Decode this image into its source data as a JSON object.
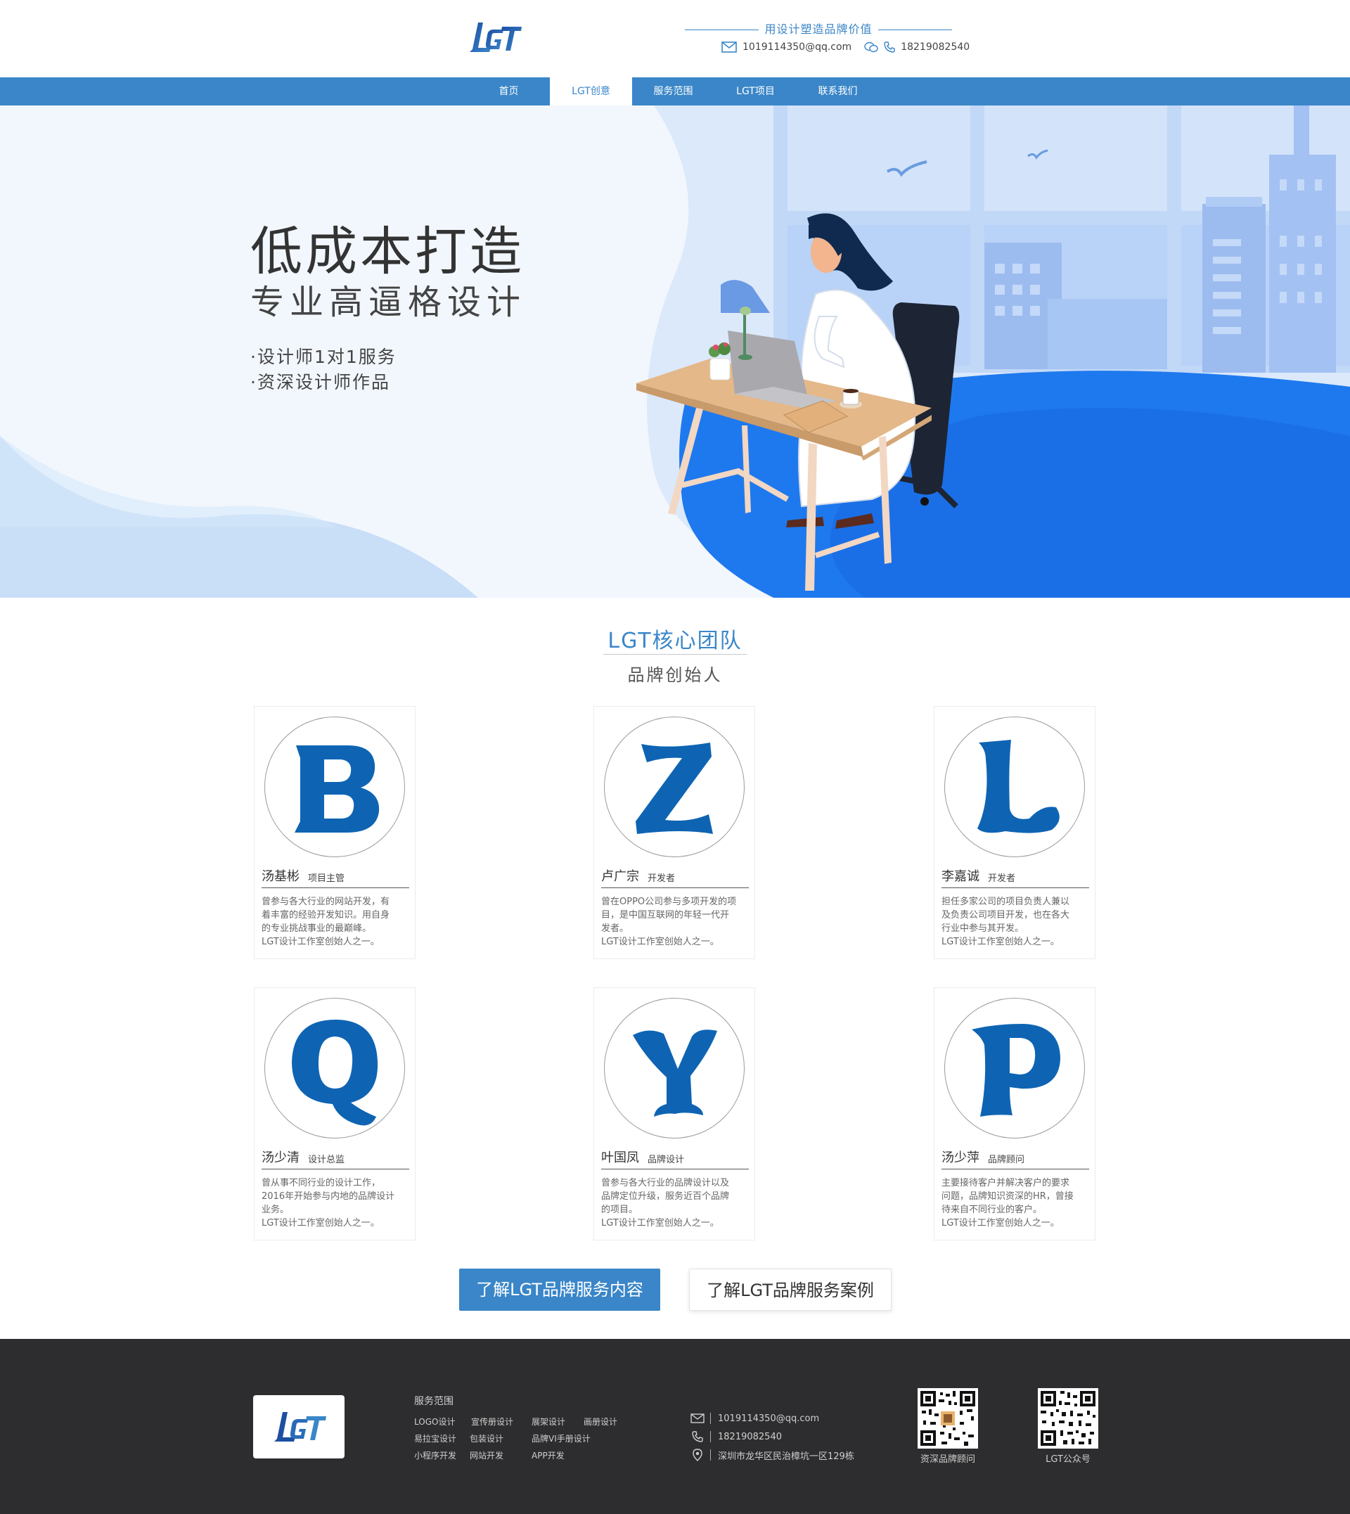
{
  "header": {
    "logo_text": "LGT",
    "slogan": "用设计塑造品牌价值",
    "email": "1019114350@qq.com",
    "phone": "18219082540"
  },
  "nav": {
    "items": [
      "首页",
      "LGT创意",
      "服务范围",
      "LGT项目",
      "联系我们"
    ],
    "active": "LGT创意"
  },
  "hero": {
    "title": "低成本打造",
    "subtitle": "专业高逼格设计",
    "points": [
      "·设计师1对1服务",
      "·资深设计师作品"
    ]
  },
  "team": {
    "title": "LGT核心团队",
    "subtitle": "品牌创始人",
    "members": [
      {
        "letter": "B",
        "name": "汤基彬",
        "role": "项目主管",
        "desc": "曾参与各大行业的网站开发，有\n着丰富的经验开发知识。用自身\n的专业挑战事业的最巅峰。\nLGT设计工作室创始人之一。"
      },
      {
        "letter": "Z",
        "name": "卢广宗",
        "role": "开发者",
        "desc": "曾在OPPO公司参与多项开发的项\n目，是中国互联网的年轻一代开\n发者。\nLGT设计工作室创始人之一。"
      },
      {
        "letter": "L",
        "name": "李嘉诚",
        "role": "开发者",
        "desc": "担任多家公司的项目负责人兼以\n及负责公司项目开发，也在各大\n行业中参与其开发。\nLGT设计工作室创始人之一。"
      },
      {
        "letter": "Q",
        "name": "汤少清",
        "role": "设计总监",
        "desc": "曾从事不同行业的设计工作，\n2016年开始参与内地的品牌设计\n业务。\nLGT设计工作室创始人之一。"
      },
      {
        "letter": "Y",
        "name": "叶国凤",
        "role": "品牌设计",
        "desc": "曾参与各大行业的品牌设计以及\n品牌定位升级，服务近百个品牌\n的项目。\nLGT设计工作室创始人之一。"
      },
      {
        "letter": "P",
        "name": "汤少萍",
        "role": "品牌顾问",
        "desc": "主要接待客户并解决客户的要求\n问题，品牌知识资深的HR，曾接\n待来自不同行业的客户。\nLGT设计工作室创始人之一。"
      }
    ]
  },
  "buttons": {
    "primary": "了解LGT品牌服务内容",
    "secondary": "了解LGT品牌服务案例"
  },
  "footer": {
    "services_title": "服务范围",
    "services": [
      [
        "LOGO设计",
        "宣传册设计",
        "展架设计",
        "画册设计"
      ],
      [
        "易拉宝设计",
        "包装设计",
        "品牌VI手册设计"
      ],
      [
        "小程序开发",
        "网站开发",
        "APP开发"
      ]
    ],
    "email": "1019114350@qq.com",
    "phone": "18219082540",
    "address": "深圳市龙华区民治樟坑一区129栋",
    "qr1_label": "资深品牌顾问",
    "qr2_label": "LGT公众号"
  },
  "colors": {
    "brand_blue": "#3a86c8",
    "footer_bg": "#2d2d2f"
  }
}
